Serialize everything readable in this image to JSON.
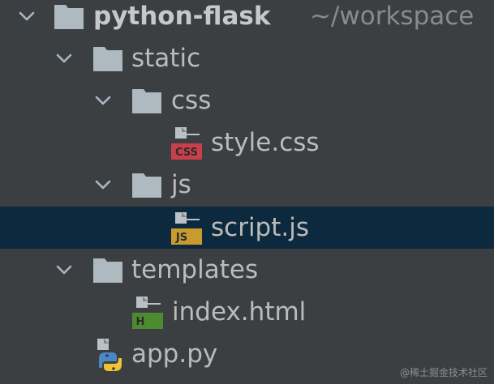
{
  "project": {
    "name": "python-flask",
    "path_hint": "~/workspace"
  },
  "tree": {
    "static": {
      "label": "static"
    },
    "css": {
      "label": "css"
    },
    "style_css": {
      "label": "style.css",
      "badge": "CSS"
    },
    "js": {
      "label": "js"
    },
    "script_js": {
      "label": "script.js",
      "badge": "JS"
    },
    "templates": {
      "label": "templates"
    },
    "index_html": {
      "label": "index.html",
      "badge": "H"
    },
    "app_py": {
      "label": "app.py"
    }
  },
  "watermark": "@稀土掘金技术社区",
  "colors": {
    "background": "#3c3f41",
    "selection": "#0d293e",
    "text": "#bbbbbb",
    "hint": "#8a8a8a",
    "folder": "#aeb9c0",
    "css_badge": "#c8404c",
    "js_badge": "#c99a2e",
    "html_badge": "#4c8b2f"
  }
}
